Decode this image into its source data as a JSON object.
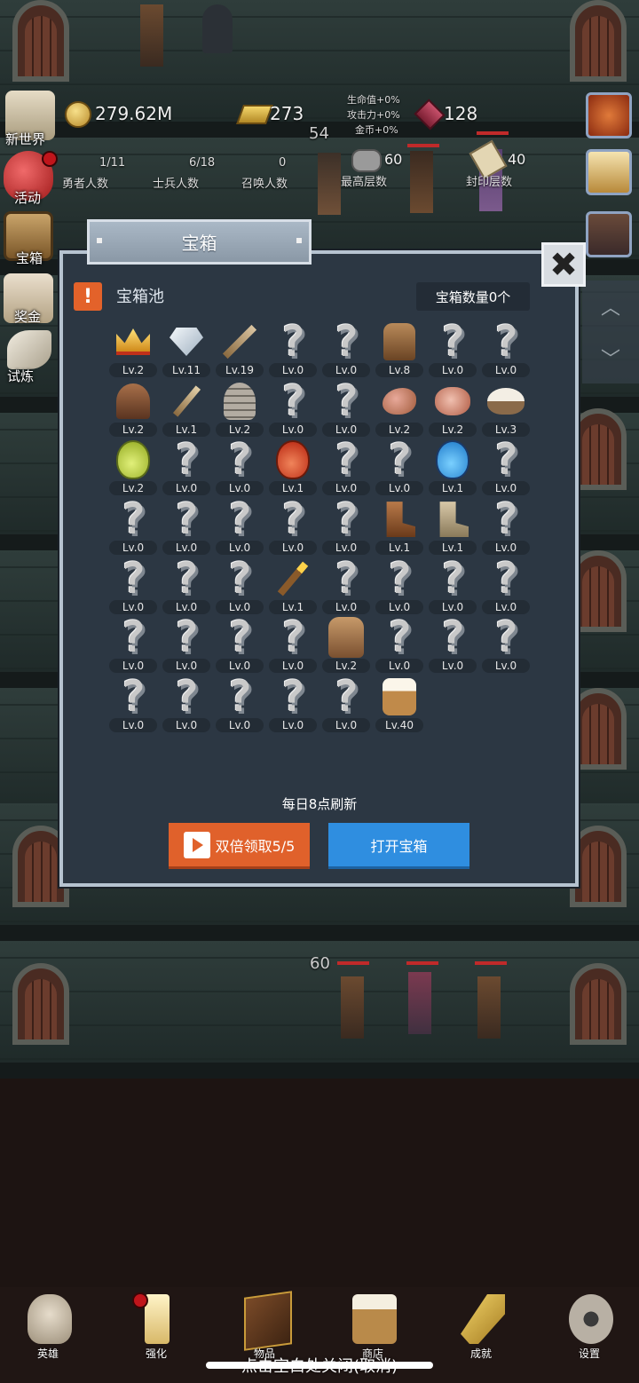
{
  "hud": {
    "gold": "279.62M",
    "ingots": "273",
    "gems": "128",
    "bonus_hp": "生命值+0%",
    "bonus_atk": "攻击力+0%",
    "bonus_gold": "金币+0%",
    "hero_count": "1/11",
    "hero_label": "勇者人数",
    "soldier_count": "6/18",
    "soldier_label": "士兵人数",
    "summon_count": "0",
    "summon_label": "召唤人数",
    "max_floor": "60",
    "max_floor_label": "最高层数",
    "sealed_floor": "40",
    "sealed_floor_label": "封印层数",
    "floor_54": "54",
    "floor_60": "60"
  },
  "side_menu": [
    {
      "label": "新世界",
      "icon": "map-icon"
    },
    {
      "label": "活动",
      "icon": "heart-icon"
    },
    {
      "label": "宝箱",
      "icon": "chest-icon"
    },
    {
      "label": "奖金",
      "icon": "letter-icon"
    },
    {
      "label": "试炼",
      "icon": "feather-icon"
    }
  ],
  "modal": {
    "title": "宝箱",
    "pool_title": "宝箱池",
    "chest_count": "宝箱数量0个",
    "refresh_text": "每日8点刷新",
    "double_button": "双倍领取5/5",
    "open_button": "打开宝箱",
    "close_symbol": "✖"
  },
  "items": [
    {
      "icon": "crown",
      "lv": "Lv.2"
    },
    {
      "icon": "diamond",
      "lv": "Lv.11"
    },
    {
      "icon": "sword",
      "lv": "Lv.19"
    },
    {
      "icon": "unknown",
      "lv": "Lv.0"
    },
    {
      "icon": "unknown",
      "lv": "Lv.0"
    },
    {
      "icon": "armor",
      "lv": "Lv.8"
    },
    {
      "icon": "unknown",
      "lv": "Lv.0"
    },
    {
      "icon": "unknown",
      "lv": "Lv.0"
    },
    {
      "icon": "leather-helmet",
      "lv": "Lv.2"
    },
    {
      "icon": "dagger",
      "lv": "Lv.1"
    },
    {
      "icon": "knight-helmet",
      "lv": "Lv.2"
    },
    {
      "icon": "unknown",
      "lv": "Lv.0"
    },
    {
      "icon": "unknown",
      "lv": "Lv.0"
    },
    {
      "icon": "ham",
      "lv": "Lv.2"
    },
    {
      "icon": "steak",
      "lv": "Lv.2"
    },
    {
      "icon": "rice-bowl",
      "lv": "Lv.3"
    },
    {
      "icon": "green-potion",
      "lv": "Lv.2"
    },
    {
      "icon": "unknown",
      "lv": "Lv.0"
    },
    {
      "icon": "unknown",
      "lv": "Lv.0"
    },
    {
      "icon": "red-potion",
      "lv": "Lv.1"
    },
    {
      "icon": "unknown",
      "lv": "Lv.0"
    },
    {
      "icon": "unknown",
      "lv": "Lv.0"
    },
    {
      "icon": "blue-potion",
      "lv": "Lv.1"
    },
    {
      "icon": "unknown",
      "lv": "Lv.0"
    },
    {
      "icon": "unknown",
      "lv": "Lv.0"
    },
    {
      "icon": "unknown",
      "lv": "Lv.0"
    },
    {
      "icon": "unknown",
      "lv": "Lv.0"
    },
    {
      "icon": "unknown",
      "lv": "Lv.0"
    },
    {
      "icon": "unknown",
      "lv": "Lv.0"
    },
    {
      "icon": "leather-boot",
      "lv": "Lv.1"
    },
    {
      "icon": "cloth-boot",
      "lv": "Lv.1"
    },
    {
      "icon": "unknown",
      "lv": "Lv.0"
    },
    {
      "icon": "unknown",
      "lv": "Lv.0"
    },
    {
      "icon": "unknown",
      "lv": "Lv.0"
    },
    {
      "icon": "unknown",
      "lv": "Lv.0"
    },
    {
      "icon": "torch",
      "lv": "Lv.1"
    },
    {
      "icon": "unknown",
      "lv": "Lv.0"
    },
    {
      "icon": "unknown",
      "lv": "Lv.0"
    },
    {
      "icon": "unknown",
      "lv": "Lv.0"
    },
    {
      "icon": "unknown",
      "lv": "Lv.0"
    },
    {
      "icon": "unknown",
      "lv": "Lv.0"
    },
    {
      "icon": "unknown",
      "lv": "Lv.0"
    },
    {
      "icon": "unknown",
      "lv": "Lv.0"
    },
    {
      "icon": "unknown",
      "lv": "Lv.0"
    },
    {
      "icon": "backpack",
      "lv": "Lv.2"
    },
    {
      "icon": "unknown",
      "lv": "Lv.0"
    },
    {
      "icon": "unknown",
      "lv": "Lv.0"
    },
    {
      "icon": "unknown",
      "lv": "Lv.0"
    },
    {
      "icon": "unknown",
      "lv": "Lv.0"
    },
    {
      "icon": "unknown",
      "lv": "Lv.0"
    },
    {
      "icon": "unknown",
      "lv": "Lv.0"
    },
    {
      "icon": "unknown",
      "lv": "Lv.0"
    },
    {
      "icon": "unknown",
      "lv": "Lv.0"
    },
    {
      "icon": "beer-mug",
      "lv": "Lv.40"
    }
  ],
  "nav": [
    {
      "label": "英雄",
      "icon": "skull-icon"
    },
    {
      "label": "强化",
      "icon": "candle-icon"
    },
    {
      "label": "物品",
      "icon": "book-icon"
    },
    {
      "label": "商店",
      "icon": "beer-mug-icon"
    },
    {
      "label": "成就",
      "icon": "key-icon"
    },
    {
      "label": "设置",
      "icon": "gear-icon"
    }
  ],
  "hint": "点击空白处关闭(取消)",
  "colors": {
    "accent_orange": "#e0612b",
    "accent_blue": "#2f8ee0",
    "panel": "#2c3743"
  }
}
